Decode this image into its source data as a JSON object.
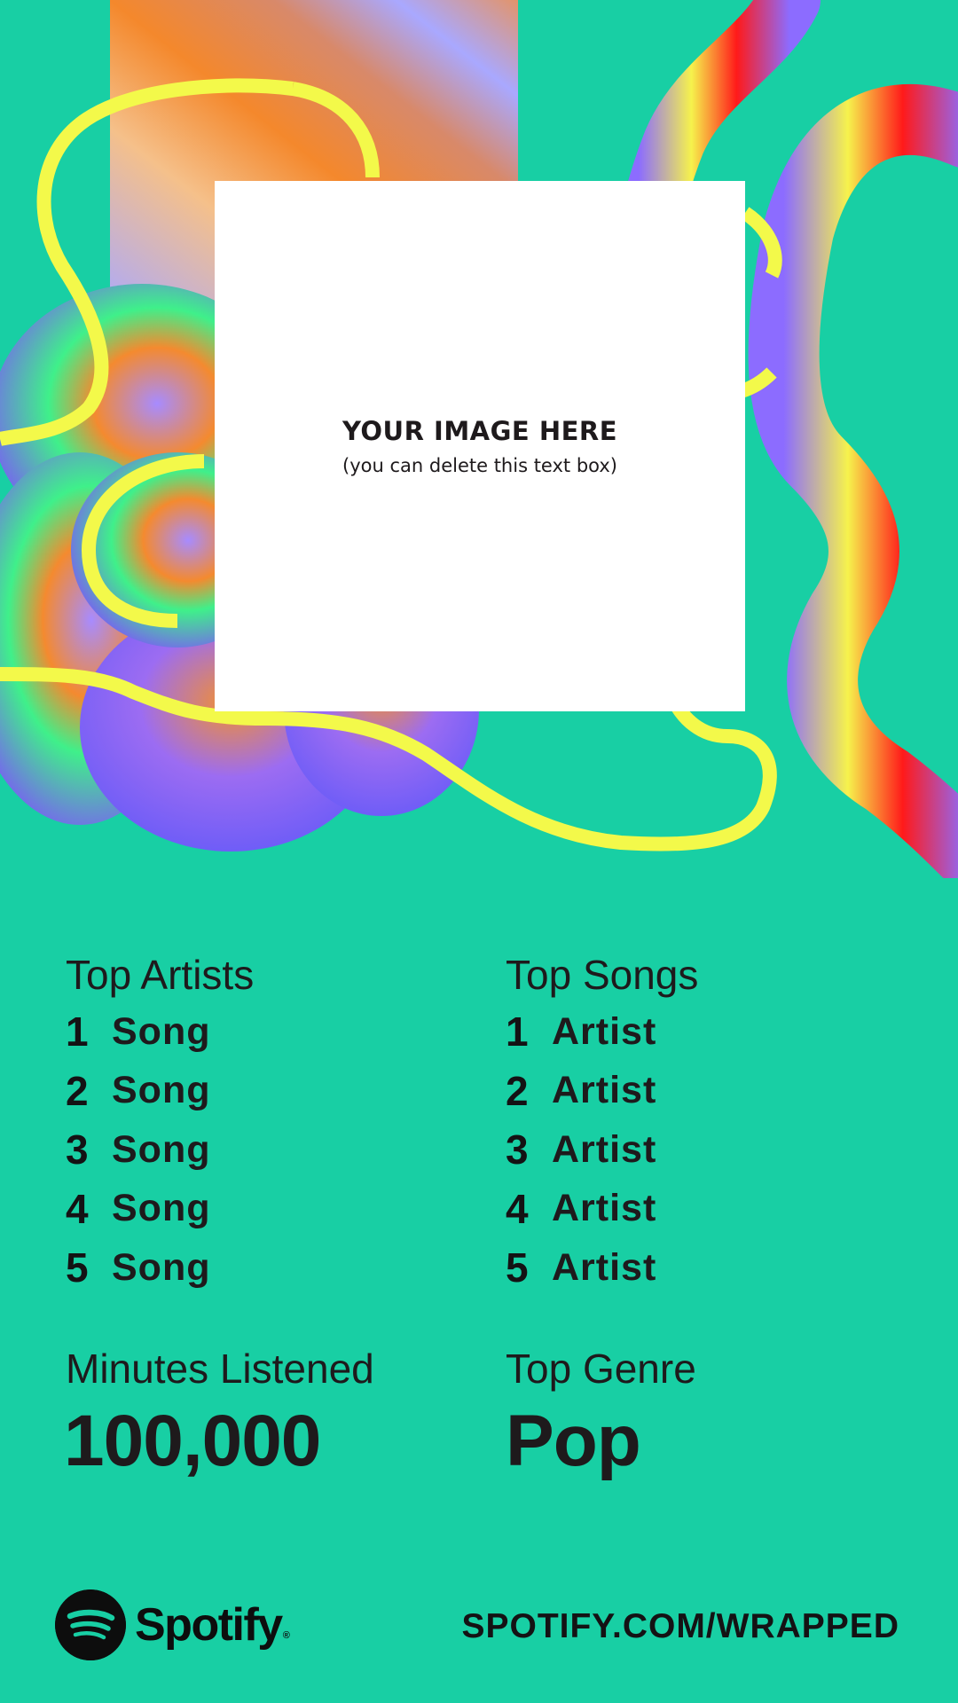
{
  "colors": {
    "background": "#18cfa4",
    "text": "#1e1a1c",
    "photo_box": "#ffffff",
    "doodle": "#f3f94a"
  },
  "photo": {
    "title": "YOUR IMAGE HERE",
    "subtitle": "(you can delete this text box)"
  },
  "left_column": {
    "heading": "Top Artists",
    "items": [
      {
        "rank": "1",
        "label": "Song"
      },
      {
        "rank": "2",
        "label": "Song"
      },
      {
        "rank": "3",
        "label": "Song"
      },
      {
        "rank": "4",
        "label": "Song"
      },
      {
        "rank": "5",
        "label": "Song"
      }
    ]
  },
  "right_column": {
    "heading": "Top Songs",
    "items": [
      {
        "rank": "1",
        "label": "Artist"
      },
      {
        "rank": "2",
        "label": "Artist"
      },
      {
        "rank": "3",
        "label": "Artist"
      },
      {
        "rank": "4",
        "label": "Artist"
      },
      {
        "rank": "5",
        "label": "Artist"
      }
    ]
  },
  "minutes": {
    "heading": "Minutes Listened",
    "value": "100,000"
  },
  "genre": {
    "heading": "Top Genre",
    "value": "Pop"
  },
  "footer": {
    "brand_icon": "spotify-logo-icon",
    "brand": "Spotify",
    "registered": "®",
    "url": "SPOTIFY.COM/WRAPPED"
  }
}
